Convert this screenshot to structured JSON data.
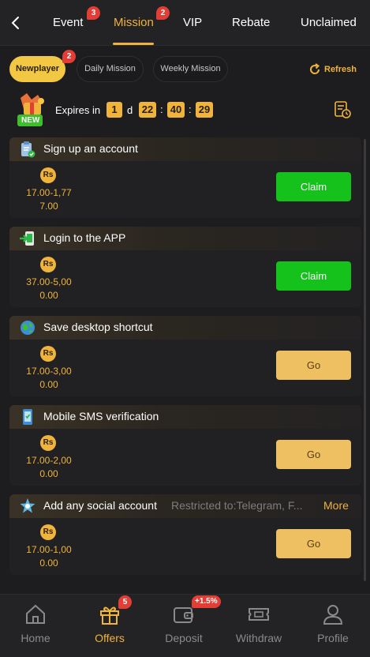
{
  "header": {
    "tabs": [
      {
        "label": "Event",
        "badge": "3"
      },
      {
        "label": "Mission",
        "badge": "2"
      },
      {
        "label": "VIP"
      },
      {
        "label": "Rebate"
      },
      {
        "label": "Unclaimed"
      }
    ],
    "active_tab": "Mission",
    "back_icon": "chevron-left-icon"
  },
  "subtabs": [
    {
      "label": "Newplayer",
      "badge": "2"
    },
    {
      "label": "Daily Mission"
    },
    {
      "label": "Weekly Mission"
    }
  ],
  "refresh_label": "Refresh",
  "expire": {
    "new_label": "NEW",
    "label": "Expires in",
    "days": "1",
    "day_unit": "d",
    "hours": "22",
    "minutes": "40",
    "seconds": "29",
    "separator": ":"
  },
  "currency_label": "Rs",
  "missions": [
    {
      "title": "Sign up an account",
      "icon": "clipboard-check-icon",
      "reward_line1": "17.00-1,77",
      "reward_line2": "7.00",
      "button": "Claim",
      "status": "claim"
    },
    {
      "title": "Login to the APP",
      "icon": "login-app-icon",
      "reward_line1": "37.00-5,00",
      "reward_line2": "0.00",
      "button": "Claim",
      "status": "claim"
    },
    {
      "title": "Save desktop shortcut",
      "icon": "globe-icon",
      "reward_line1": "17.00-3,00",
      "reward_line2": "0.00",
      "button": "Go",
      "status": "go"
    },
    {
      "title": "Mobile SMS verification",
      "icon": "phone-sms-icon",
      "reward_line1": "17.00-2,00",
      "reward_line2": "0.00",
      "button": "Go",
      "status": "go"
    },
    {
      "title": "Add any social account",
      "icon": "social-star-icon",
      "restriction": "Restricted to:Telegram, F...",
      "more": "More",
      "reward_line1": "17.00-1,00",
      "reward_line2": "0.00",
      "button": "Go",
      "status": "go"
    }
  ],
  "bottom_nav": [
    {
      "label": "Home",
      "icon": "home-icon"
    },
    {
      "label": "Offers",
      "icon": "gift-icon",
      "badge": "5"
    },
    {
      "label": "Deposit",
      "icon": "wallet-icon",
      "badge": "+1.5%"
    },
    {
      "label": "Withdraw",
      "icon": "ticket-icon"
    },
    {
      "label": "Profile",
      "icon": "person-icon"
    }
  ],
  "active_nav": "Offers",
  "colors": {
    "accent": "#f0b33c",
    "claim": "#14c21b",
    "go": "#eec062",
    "badge": "#e33e36",
    "background": "#1d1d1f"
  }
}
